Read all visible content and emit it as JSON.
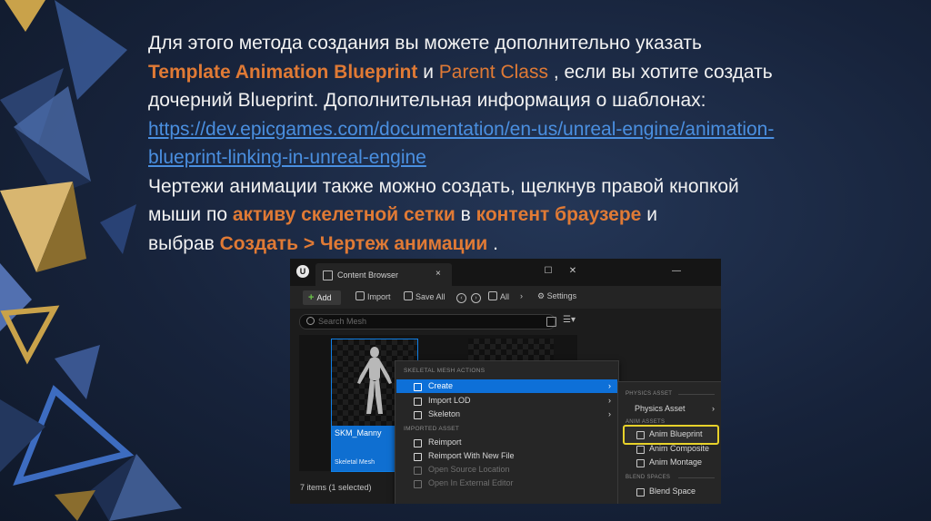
{
  "slide": {
    "line1": "Для этого метода создания вы можете дополнительно указать",
    "line2_highlight": "Template Animation Blueprint",
    "line2_and": " и ",
    "line2_parent": "Parent Class",
    "line2_rest": " , если вы хотите создать",
    "line3": "дочерний Blueprint. Дополнительная информация о шаблонах:",
    "link_line1": "https://dev.epicgames.com/documentation/en-us/unreal-engine/animation-",
    "link_line2": "blueprint-linking-in-unreal-engine",
    "line5": "Чертежи анимации также можно создать, щелкнув правой кнопкой",
    "line6_start": "мыши по ",
    "line6_hl1": "активу скелетной сетки",
    "line6_mid": " в ",
    "line6_hl2": "контент браузере",
    "line6_end": " и",
    "line7_start": "выбрав ",
    "line7_hl": "Создать > Чертеж анимации",
    "line7_end": " ."
  },
  "colors": {
    "highlight": "#e07a35",
    "link": "#4a8fe0",
    "menu_active": "#0e70d8",
    "callout": "#e8d22a"
  },
  "screenshot": {
    "logo": "U",
    "tab_title": "Content Browser",
    "tab_close": "×",
    "window_minimize": "—",
    "window_maximize": "☐",
    "window_close": "✕",
    "toolbar": {
      "add": "Add",
      "import": "Import",
      "save_all": "Save All",
      "all": "All",
      "settings": "Settings"
    },
    "search_placeholder": "Search Mesh",
    "asset": {
      "name": "SKM_Manny",
      "type": "Skeletal Mesh"
    },
    "items_count": "7 items (1 selected)",
    "context_menu": {
      "header1": "SKELETAL MESH ACTIONS",
      "create": "Create",
      "import_lod": "Import LOD",
      "skeleton": "Skeleton",
      "header2": "IMPORTED ASSET",
      "reimport": "Reimport",
      "reimport_new": "Reimport With New File",
      "open_source": "Open Source Location",
      "open_external": "Open In External Editor"
    },
    "submenu": {
      "header1": "PHYSICS ASSET",
      "physics_asset": "Physics Asset",
      "header2": "ANIM ASSETS",
      "anim_blueprint": "Anim Blueprint",
      "anim_composite": "Anim Composite",
      "anim_montage": "Anim Montage",
      "header3": "BLEND SPACES",
      "blend_space": "Blend Space"
    }
  }
}
